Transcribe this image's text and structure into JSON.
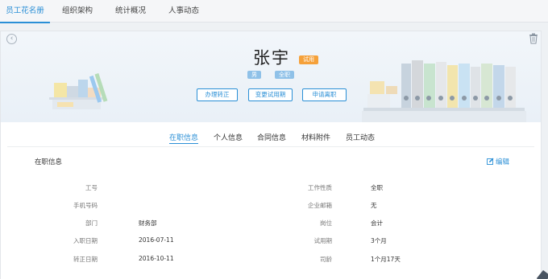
{
  "top_nav": {
    "tabs": [
      "员工花名册",
      "组织架构",
      "统计概况",
      "人事动态"
    ],
    "active_index": 0
  },
  "profile": {
    "name": "张宇",
    "status_badge": "试用",
    "tags": [
      "男",
      "全职"
    ],
    "actions": [
      "办理转正",
      "变更试用期",
      "申请离职"
    ]
  },
  "sub_tabs": {
    "items": [
      "在职信息",
      "个人信息",
      "合同信息",
      "材料附件",
      "员工动态"
    ],
    "active_index": 0
  },
  "section": {
    "title": "在职信息",
    "edit_label": "编辑"
  },
  "fields_left": [
    {
      "label": "工号",
      "value": ""
    },
    {
      "label": "手机号码",
      "value": ""
    },
    {
      "label": "部门",
      "value": "财务部"
    },
    {
      "label": "入职日期",
      "value": "2016-07-11"
    },
    {
      "label": "转正日期",
      "value": "2016-10-11"
    }
  ],
  "fields_right": [
    {
      "label": "工作性质",
      "value": "全职"
    },
    {
      "label": "企业邮箱",
      "value": "无"
    },
    {
      "label": "岗位",
      "value": "会计"
    },
    {
      "label": "试用期",
      "value": "3个月"
    },
    {
      "label": "司龄",
      "value": "1个月17天"
    }
  ],
  "colors": {
    "accent": "#2a8fd6",
    "badge": "#f5a13a",
    "tag": "#8fc1e8"
  },
  "icons": {
    "back": "chevron-left-circle-icon",
    "delete": "trash-icon",
    "edit": "pencil-square-icon"
  }
}
